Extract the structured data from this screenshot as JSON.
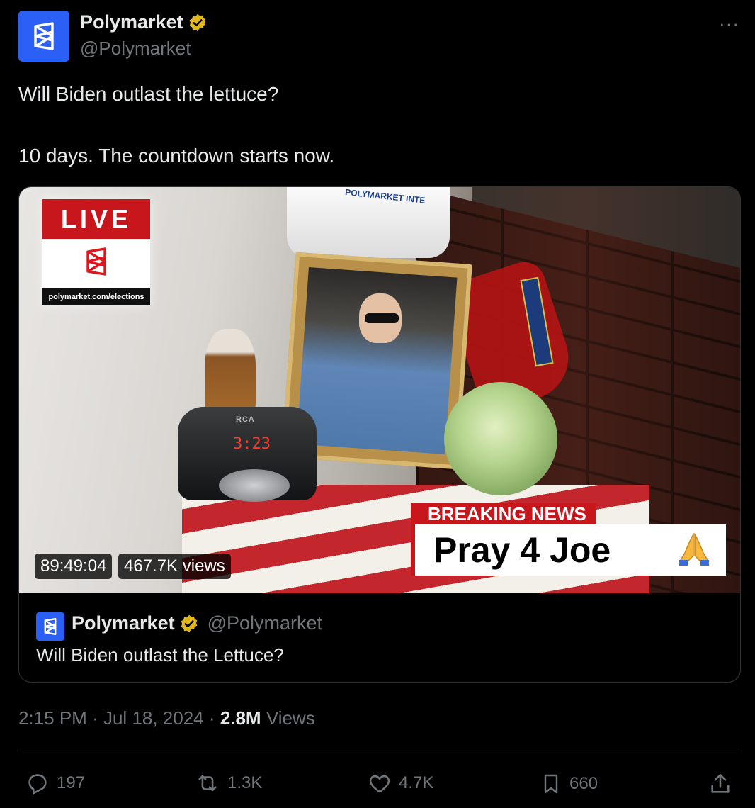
{
  "author": {
    "name": "Polymarket",
    "handle": "@Polymarket",
    "verified": true,
    "avatar_icon": "polymarket-logo-icon",
    "brand_color": "#2c5ff6"
  },
  "menu_label": "···",
  "tweet": {
    "line1": "Will Biden outlast the lettuce?",
    "line2": "10 days. The countdown starts now."
  },
  "media": {
    "live_label": "LIVE",
    "live_url": "polymarket.com/elections",
    "hat_text": "POLYMARKET INTE",
    "clock_brand": "RCA",
    "clock_time": "3:23",
    "breaking_label": "BREAKING NEWS",
    "breaking_text": "Pray 4 Joe",
    "breaking_emoji": "🙏",
    "duration": "89:49:04",
    "views": "467.7K views"
  },
  "quoted": {
    "name": "Polymarket",
    "handle": "@Polymarket",
    "text": "Will Biden outlast the Lettuce?"
  },
  "meta": {
    "time": "2:15 PM",
    "sep1": "·",
    "date": "Jul 18, 2024",
    "sep2": "·",
    "views_count": "2.8M",
    "views_label": "Views"
  },
  "actions": {
    "replies": "197",
    "reposts": "1.3K",
    "likes": "4.7K",
    "bookmarks": "660"
  },
  "colors": {
    "background": "#000000",
    "text": "#e7e9ea",
    "muted": "#71767b",
    "verified_gold": "#e2b719",
    "live_red": "#c8161d"
  }
}
